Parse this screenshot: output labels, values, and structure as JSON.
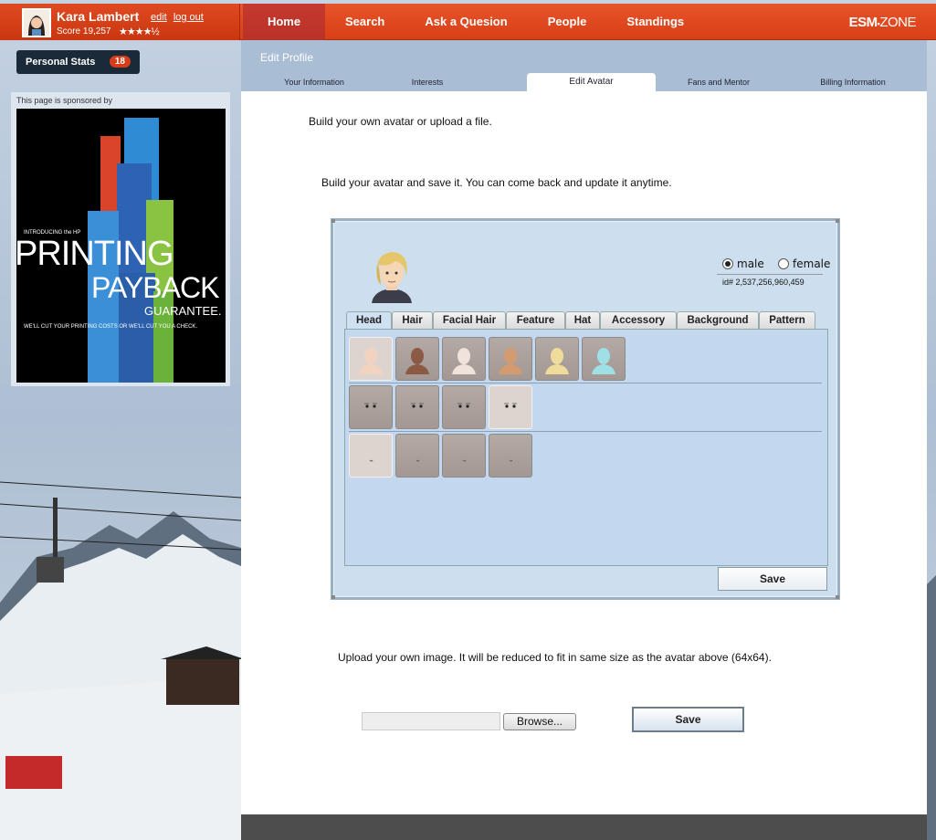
{
  "user": {
    "name": "Kara Lambert",
    "edit_link": "edit",
    "logout_link": "log out",
    "score_label": "Score 19,257",
    "stars": "★★★★½"
  },
  "nav": {
    "items": [
      "Home",
      "Search",
      "Ask a Quesion",
      "People",
      "Standings"
    ],
    "logo_left": "ESM",
    "logo_right": "ZONE"
  },
  "sidebar": {
    "personal_stats_label": "Personal Stats",
    "personal_stats_count": "18",
    "sponsor_text": "This page is sponsored by",
    "ad": {
      "intro": "INTRODUCING the HP",
      "line1": "PRINTING",
      "line2": "PAYBACK",
      "line3": "GUARANTEE.",
      "tagline": "WE'LL CUT YOUR PRINTING COSTS OR WE'LL CUT YOU A CHECK."
    }
  },
  "profile": {
    "section_title": "Edit Profile",
    "tabs": [
      "Your Information",
      "Interests",
      "Edit Avatar",
      "Fans and Mentor",
      "Billing Information"
    ],
    "active_tab": "Edit Avatar",
    "intro": "Build your own avatar or upload a file.",
    "builder_intro": "Build your avatar and save it. You can come back and update it anytime.",
    "upload_text": "Upload your own image. It will be reduced to fit in same size as the avatar above (64x64).",
    "browse_label": "Browse...",
    "save_label": "Save"
  },
  "builder": {
    "gender_options": [
      "male",
      "female"
    ],
    "selected_gender": "male",
    "avatar_id": "id# 2,537,256,960,459",
    "tabs": [
      "Head",
      "Hair",
      "Facial Hair",
      "Feature",
      "Hat",
      "Accessory",
      "Background",
      "Pattern"
    ],
    "active_tab": "Head",
    "save_label": "Save",
    "colors": {
      "skin_tones": [
        "#f2d3c0",
        "#8a5a44",
        "#efe3dc",
        "#d49a70",
        "#f0dc9a",
        "#9fe0e6"
      ],
      "swatch_bg": "#b3a9a5",
      "swatch_bg_selected": "#ddd4cf"
    }
  }
}
